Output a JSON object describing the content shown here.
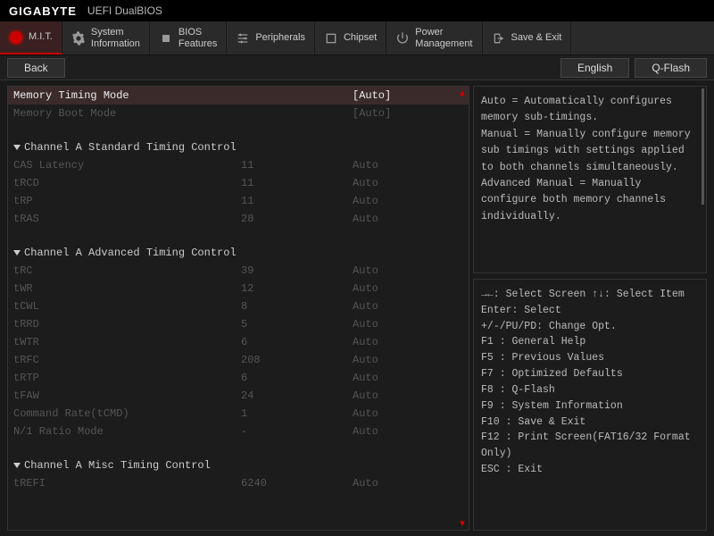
{
  "header": {
    "brand": "GIGABYTE",
    "subbrand": "UEFI DualBIOS"
  },
  "tabs": [
    {
      "label": "M.I.T.",
      "active": true
    },
    {
      "label": "System\nInformation"
    },
    {
      "label": "BIOS\nFeatures"
    },
    {
      "label": "Peripherals"
    },
    {
      "label": "Chipset"
    },
    {
      "label": "Power\nManagement"
    },
    {
      "label": "Save & Exit"
    }
  ],
  "subbar": {
    "back": "Back",
    "english": "English",
    "qflash": "Q-Flash"
  },
  "top_settings": [
    {
      "label": "Memory Timing Mode",
      "value": "[Auto]",
      "selected": true
    },
    {
      "label": "Memory Boot Mode",
      "value": "[Auto]",
      "dim": true
    }
  ],
  "sections": [
    {
      "title": "Channel A Standard Timing Control",
      "rows": [
        {
          "label": "CAS Latency",
          "detected": "11",
          "value": "Auto"
        },
        {
          "label": "tRCD",
          "detected": "11",
          "value": "Auto"
        },
        {
          "label": "tRP",
          "detected": "11",
          "value": "Auto"
        },
        {
          "label": "tRAS",
          "detected": "28",
          "value": "Auto"
        }
      ]
    },
    {
      "title": "Channel A Advanced Timing Control",
      "rows": [
        {
          "label": "tRC",
          "detected": "39",
          "value": "Auto"
        },
        {
          "label": "tWR",
          "detected": "12",
          "value": "Auto"
        },
        {
          "label": "tCWL",
          "detected": "8",
          "value": "Auto"
        },
        {
          "label": "tRRD",
          "detected": "5",
          "value": "Auto"
        },
        {
          "label": "tWTR",
          "detected": "6",
          "value": "Auto"
        },
        {
          "label": "tRFC",
          "detected": "208",
          "value": "Auto"
        },
        {
          "label": "tRTP",
          "detected": "6",
          "value": "Auto"
        },
        {
          "label": "tFAW",
          "detected": "24",
          "value": "Auto"
        },
        {
          "label": "Command Rate(tCMD)",
          "detected": "1",
          "value": "Auto"
        },
        {
          "label": "N/1 Ratio Mode",
          "detected": "-",
          "value": "Auto"
        }
      ]
    },
    {
      "title": "Channel A Misc Timing Control",
      "rows": [
        {
          "label": "tREFI",
          "detected": "6240",
          "value": "Auto"
        }
      ]
    }
  ],
  "info": "Auto = Automatically configures memory sub-timings.\nManual = Manually configure memory sub timings with settings applied to both channels simultaneously.\nAdvanced Manual = Manually configure both memory channels individually.",
  "help": [
    "→←: Select Screen  ↑↓: Select Item",
    "Enter: Select",
    "+/-/PU/PD: Change Opt.",
    "F1  : General Help",
    "F5  : Previous Values",
    "F7  : Optimized Defaults",
    "F8  : Q-Flash",
    "F9  : System Information",
    "F10 : Save & Exit",
    "F12 : Print Screen(FAT16/32 Format Only)",
    "ESC : Exit"
  ]
}
